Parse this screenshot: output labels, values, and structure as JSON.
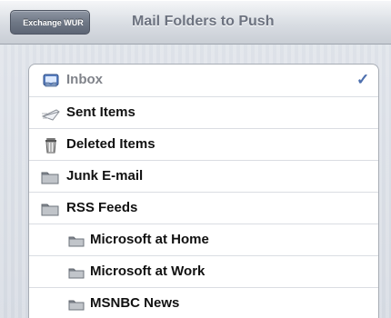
{
  "header": {
    "back_label": "Exchange WUR",
    "title": "Mail Folders to Push"
  },
  "folders": [
    {
      "label": "Inbox",
      "icon": "inbox-icon",
      "selected": true
    },
    {
      "label": "Sent Items",
      "icon": "sent-items-icon",
      "selected": false
    },
    {
      "label": "Deleted Items",
      "icon": "trash-icon",
      "selected": false
    },
    {
      "label": "Junk E-mail",
      "icon": "folder-icon",
      "selected": false
    },
    {
      "label": "RSS Feeds",
      "icon": "folder-icon",
      "selected": false
    },
    {
      "label": "Microsoft at Home",
      "icon": "folder-icon",
      "selected": false
    },
    {
      "label": "Microsoft at Work",
      "icon": "folder-icon",
      "selected": false
    },
    {
      "label": "MSNBC News",
      "icon": "folder-icon",
      "selected": false
    }
  ],
  "selection": {
    "checkmark": "✓"
  }
}
